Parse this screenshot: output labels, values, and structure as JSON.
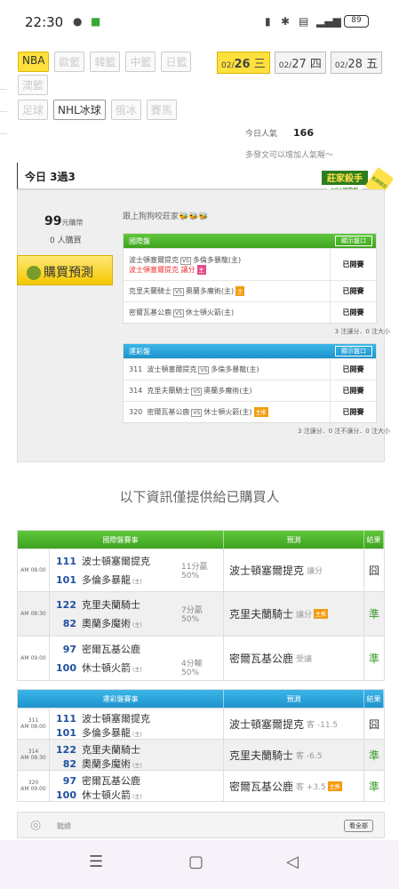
{
  "status": {
    "time": "22:30",
    "battery": "89"
  },
  "sports_row1": [
    "NBA",
    "歐籃",
    "韓籃",
    "中籃",
    "日籃"
  ],
  "sports_row2": [
    "澳籃"
  ],
  "sports_row3": [
    "足球",
    "NHL冰球",
    "俄冰",
    "賽馬"
  ],
  "dates": [
    {
      "d": "02/",
      "n": "26",
      "w": "三"
    },
    {
      "d": "02/",
      "n": "27",
      "w": "四"
    },
    {
      "d": "02/",
      "n": "28",
      "w": "五"
    }
  ],
  "popularity": {
    "label": "今日人氣",
    "value": "166"
  },
  "post_note": "多發文可以增加人氣喔～",
  "badge": {
    "line1": "莊家殺手",
    "line2": "NBA國際盤",
    "line3": "長期穩定"
  },
  "tab": "今日 3過3",
  "price": {
    "value": "99",
    "unit": "元購幣"
  },
  "buyers": "0 人購買",
  "buy_label": "購買預測",
  "follow": "跟上狗狗咬莊家🐝🐝🐝",
  "intl_box": {
    "title": "國際盤",
    "show": "顯示盤口",
    "rows": [
      {
        "a": "波士頓塞爾提克",
        "b": "多倫多暴龍(主)",
        "sub": "波士頓塞爾提克 讓分",
        "status": "已開賽"
      },
      {
        "a": "克里夫蘭騎士",
        "b": "奧蘭多魔術(主)",
        "sub": "",
        "status": "已開賽"
      },
      {
        "a": "密爾瓦基公鹿",
        "b": "休士頓火箭(主)",
        "sub": "",
        "status": "已開賽"
      }
    ],
    "note": "3 注讓分．0 注大小"
  },
  "lottery_box": {
    "title": "運彩盤",
    "show": "顯示盤口",
    "rows": [
      {
        "no": "311",
        "a": "波士頓塞爾提克",
        "b": "多倫多暴龍(主)",
        "status": "已開賽"
      },
      {
        "no": "314",
        "a": "克里夫蘭騎士",
        "b": "奧蘭多魔術(主)",
        "status": "已開賽"
      },
      {
        "no": "320",
        "a": "密爾瓦基公鹿",
        "b": "休士頓火箭(主)",
        "status": "已開賽"
      }
    ],
    "note": "3 注讓分．0 注不讓分．0 注大小"
  },
  "info": "以下資訊僅提供給已購買人",
  "t1": {
    "h1": "國際盤賽事",
    "h2": "預測",
    "h3": "結果",
    "rows": [
      {
        "time": "AM 08:00",
        "n1": "111",
        "t1": "波士頓塞爾提克",
        "n2": "101",
        "t2": "多倫多暴龍",
        "s1": "11分贏",
        "s2": "50%",
        "pick": "波士頓塞爾提克",
        "ptype": "讓分",
        "res": "囧"
      },
      {
        "time": "AM 08:30",
        "n1": "122",
        "t1": "克里夫蘭騎士",
        "n2": "82",
        "t2": "奧蘭多魔術",
        "s1": "7分贏",
        "s2": "50%",
        "pick": "克里夫蘭騎士",
        "ptype": "讓分",
        "res": "準"
      },
      {
        "time": "AM 09:00",
        "n1": "97",
        "t1": "密爾瓦基公鹿",
        "n2": "100",
        "t2": "休士頓火箭",
        "s1": "4分輸",
        "s2": "50%",
        "pick": "密爾瓦基公鹿",
        "ptype": "受讓",
        "res": "準"
      }
    ]
  },
  "t2": {
    "h1": "運彩盤賽事",
    "h2": "預測",
    "h3": "結果",
    "rows": [
      {
        "no": "311",
        "time": "AM 08:00",
        "n1": "111",
        "t1": "波士頓塞爾提克",
        "n2": "101",
        "t2": "多倫多暴龍",
        "pick": "波士頓塞爾提克",
        "ptype": "客 -11.5",
        "res": "囧"
      },
      {
        "no": "314",
        "time": "AM 08:30",
        "n1": "122",
        "t1": "克里夫蘭騎士",
        "n2": "82",
        "t2": "奧蘭多魔術",
        "pick": "克里夫蘭騎士",
        "ptype": "客 -6.5",
        "res": "準"
      },
      {
        "no": "320",
        "time": "AM 09:00",
        "n1": "97",
        "t1": "密爾瓦基公鹿",
        "n2": "100",
        "t2": "休士頓火箭",
        "pick": "密爾瓦基公鹿",
        "ptype": "客 +3.5",
        "res": "準"
      }
    ]
  },
  "home_tag": "主",
  "main_tag": "主推",
  "z": "(主)",
  "bottom": {
    "label": "戰績",
    "see_all": "看全部"
  }
}
